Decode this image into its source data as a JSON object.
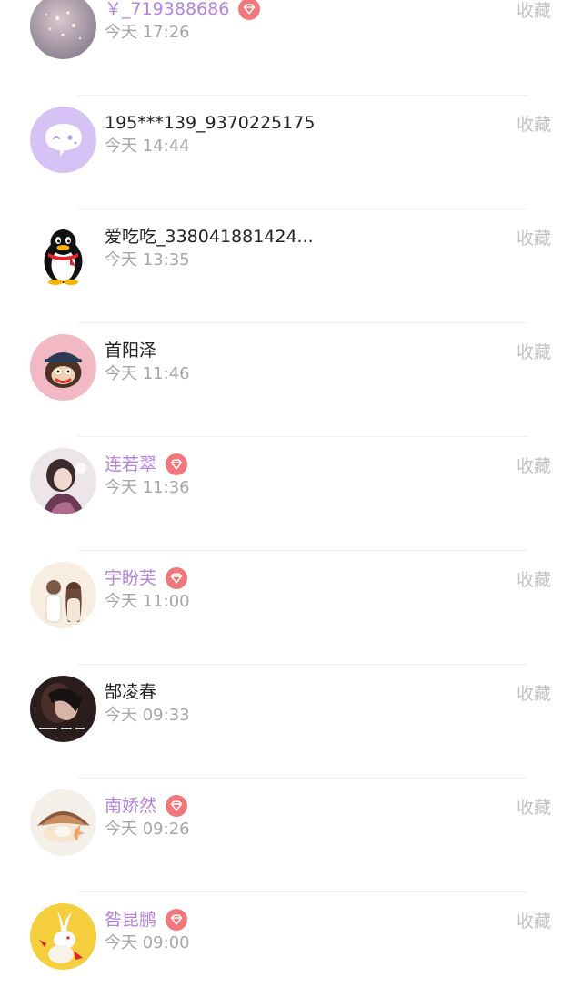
{
  "favorite_label": "收藏",
  "colors": {
    "vip_name": "#b583dd",
    "normal_name": "#222222",
    "time": "#a6a6a6",
    "favorite": "#c2c2c2",
    "vip_badge": "#f0787c"
  },
  "rows": [
    {
      "name": "￥_719388686",
      "vip": true,
      "time": "今天 17:26",
      "avatar": "sparkle-photo"
    },
    {
      "name": "195***139_9370225175",
      "vip": false,
      "time": "今天 14:44",
      "avatar": "purple-chat-bubble"
    },
    {
      "name": "爱吃吃_338041881424...",
      "vip": false,
      "time": "今天 13:35",
      "avatar": "qq-penguin"
    },
    {
      "name": "首阳泽",
      "vip": false,
      "time": "今天 11:46",
      "avatar": "pink-monkey"
    },
    {
      "name": "连若翠",
      "vip": true,
      "time": "今天 11:36",
      "avatar": "girl-photo"
    },
    {
      "name": "宇盼芙",
      "vip": true,
      "time": "今天 11:00",
      "avatar": "couple-drawing"
    },
    {
      "name": "郜凌春",
      "vip": false,
      "time": "今天 09:33",
      "avatar": "dark-girl-photo"
    },
    {
      "name": "南娇然",
      "vip": true,
      "time": "今天 09:26",
      "avatar": "seashell"
    },
    {
      "name": "咎昆鹏",
      "vip": true,
      "time": "今天 09:00",
      "avatar": "yellow-rabbit"
    }
  ]
}
